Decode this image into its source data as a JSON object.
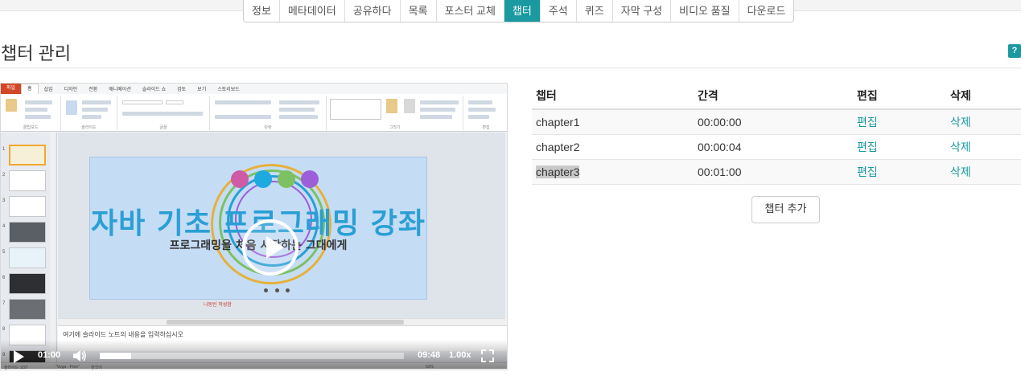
{
  "tabs": [
    {
      "label": "정보",
      "active": false
    },
    {
      "label": "메타데이터",
      "active": false
    },
    {
      "label": "공유하다",
      "active": false
    },
    {
      "label": "목록",
      "active": false
    },
    {
      "label": "포스터 교체",
      "active": false
    },
    {
      "label": "챕터",
      "active": true
    },
    {
      "label": "주석",
      "active": false
    },
    {
      "label": "퀴즈",
      "active": false
    },
    {
      "label": "자막 구성",
      "active": false
    },
    {
      "label": "비디오 품질",
      "active": false
    },
    {
      "label": "다운로드",
      "active": false
    }
  ],
  "page": {
    "title": "챕터 관리",
    "help_icon": "?"
  },
  "video": {
    "ribbon_tabs": [
      "파일",
      "홈",
      "삽입",
      "디자인",
      "전환",
      "애니메이션",
      "슬라이드 쇼",
      "검토",
      "보기",
      "스토리보드"
    ],
    "ribbon_groups": [
      "클립보드",
      "슬라이드",
      "글꼴",
      "단락",
      "그리기",
      "편집"
    ],
    "slide_title": "자바 기초 프로그래밍 강좌",
    "slide_subtitle": "프로그래밍을 처음 시작하는 그대에게",
    "slide_caption": "나동빈 작성함",
    "notes_text": "여기에 슬라이드 노트의 내용을 입력하십시오",
    "status_left": "슬라이드 1/27",
    "status_theme": "\"Vega - Free\"",
    "status_lang": "한국어",
    "status_zoom": "52%",
    "thumb_numbers": [
      "1",
      "2",
      "3",
      "4",
      "5",
      "6",
      "7",
      "8",
      "9"
    ],
    "current_time": "01:00",
    "duration": "09:48",
    "speed": "1.00x",
    "progress": 0.102,
    "colors": {
      "dot1": "#cf5aa6",
      "dot2": "#1ea9e1",
      "dot3": "#7dc163",
      "dot4": "#9b5fd9"
    }
  },
  "table": {
    "headers": {
      "chapter": "챕터",
      "interval": "간격",
      "edit": "편집",
      "delete": "삭제"
    },
    "rows": [
      {
        "chapter": "chapter1",
        "interval": "00:00:00",
        "edit": "편집",
        "delete": "삭제"
      },
      {
        "chapter": "chapter2",
        "interval": "00:00:04",
        "edit": "편집",
        "delete": "삭제"
      },
      {
        "chapter": "chapter3",
        "interval": "00:01:00",
        "edit": "편집",
        "delete": "삭제"
      }
    ]
  },
  "add_button": "챕터 추가",
  "accent": "#1a9aa0"
}
